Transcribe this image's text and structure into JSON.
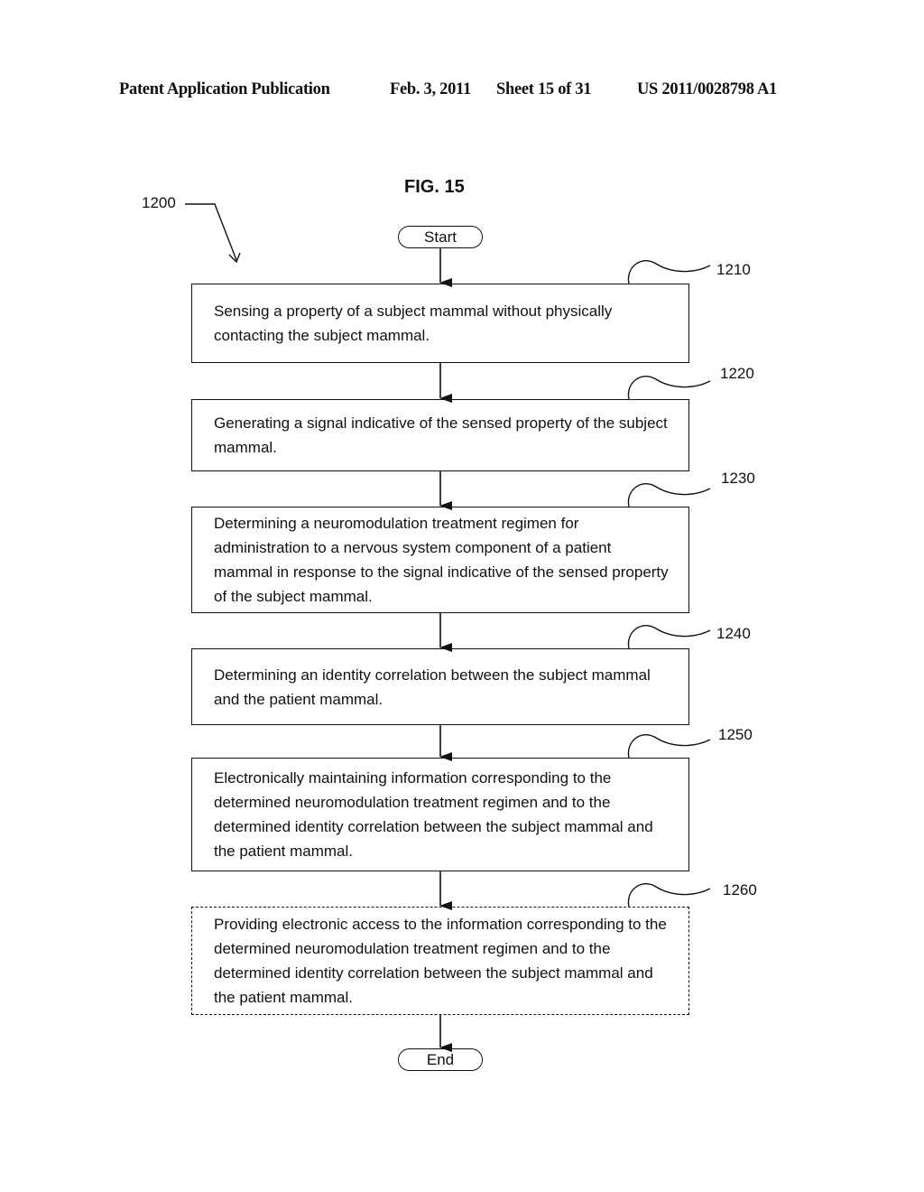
{
  "header": {
    "left": "Patent Application Publication",
    "date": "Feb. 3, 2011",
    "sheet": "Sheet 15 of 31",
    "number": "US 2011/0028798 A1"
  },
  "figure": {
    "title": "FIG. 15",
    "ref": "1200",
    "start_label": "Start",
    "end_label": "End",
    "steps": [
      {
        "ref": "1210",
        "optional": false,
        "text": "Sensing a property of a subject mammal without physically contacting the subject mammal."
      },
      {
        "ref": "1220",
        "optional": false,
        "text": "Generating a signal indicative of the sensed property of the subject mammal."
      },
      {
        "ref": "1230",
        "optional": false,
        "text": "Determining a neuromodulation treatment regimen for administration to a nervous system component of a patient mammal in response to the signal indicative of the sensed property of the subject mammal."
      },
      {
        "ref": "1240",
        "optional": false,
        "text": "Determining an identity correlation between the subject mammal and the patient mammal."
      },
      {
        "ref": "1250",
        "optional": false,
        "text": "Electronically maintaining information corresponding to the determined neuromodulation treatment regimen and to the determined identity correlation between the subject mammal and the patient mammal."
      },
      {
        "ref": "1260",
        "optional": true,
        "text": "Providing electronic access to the information corresponding to the determined neuromodulation treatment regimen and to the determined identity correlation between the subject mammal and the patient mammal."
      }
    ]
  }
}
